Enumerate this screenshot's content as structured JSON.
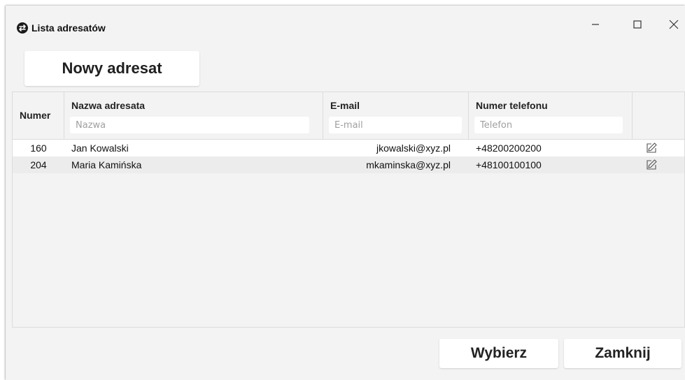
{
  "window": {
    "title": "Lista adresatów",
    "app_icon": "swap-arrows-icon",
    "controls": [
      "minimize-icon",
      "maximize-icon",
      "close-icon"
    ]
  },
  "toolbar": {
    "new_button_label": "Nowy adresat"
  },
  "table": {
    "columns": [
      {
        "label": "Numer"
      },
      {
        "label": "Nazwa adresata",
        "filter_placeholder": "Nazwa",
        "filter_value": ""
      },
      {
        "label": "E-mail",
        "filter_placeholder": "E-mail",
        "filter_value": ""
      },
      {
        "label": "Numer telefonu",
        "filter_placeholder": "Telefon",
        "filter_value": ""
      },
      {
        "label": ""
      }
    ],
    "rows": [
      {
        "number": "160",
        "name": "Jan Kowalski",
        "email": "jkowalski@xyz.pl",
        "phone": "+48200200200",
        "action_icon": "edit-icon"
      },
      {
        "number": "204",
        "name": "Maria Kamińska",
        "email": "mkaminska@xyz.pl",
        "phone": "+48100100100",
        "action_icon": "edit-icon"
      }
    ]
  },
  "footer": {
    "choose_label": "Wybierz",
    "close_label": "Zamknij"
  }
}
